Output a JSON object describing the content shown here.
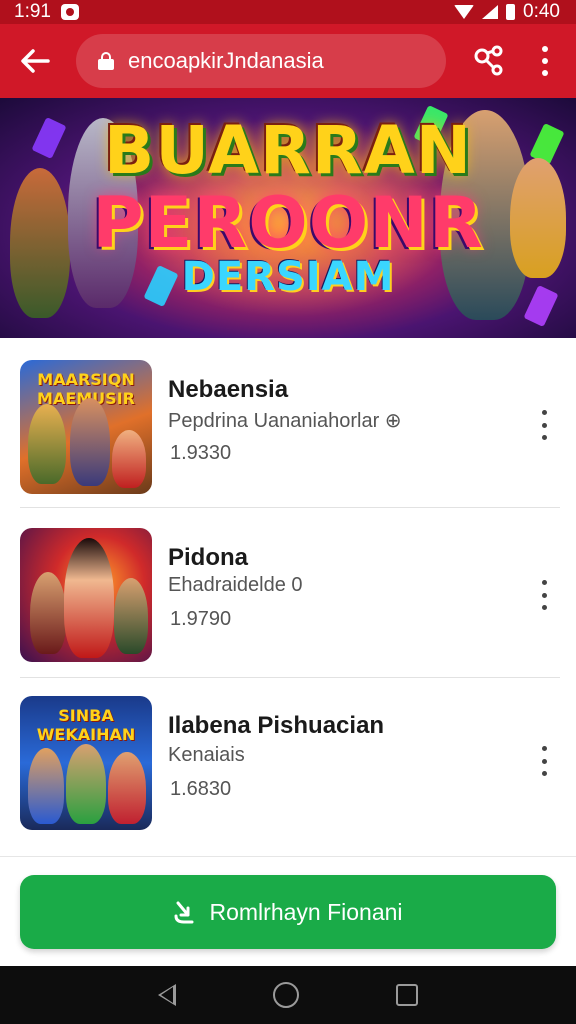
{
  "status_bar": {
    "time": "1:91",
    "clock_right": "0:40"
  },
  "browser": {
    "url": "encoapkirJndanasia",
    "icons": [
      "back-arrow-icon",
      "lock-icon",
      "share-icon",
      "more-vert-icon"
    ]
  },
  "banner": {
    "line1": "BUARRAN",
    "line2": "PEROONR",
    "line3": "DERSIAM"
  },
  "apps": [
    {
      "thumb_title": "MAARSIQN MAEMUSIR",
      "name": "Nebaensia",
      "subtitle": "Pepdrina Uananiahorlar ⊕",
      "count": "1.9330"
    },
    {
      "thumb_title": "",
      "name": "Pidona",
      "subtitle": "Ehadraidelde 0",
      "count": "1.9790"
    },
    {
      "thumb_title": "SINBA WEKAIHAN",
      "name": "Ilabena Pishuacian",
      "subtitle": "Kenaiais",
      "count": "1.6830"
    }
  ],
  "install_button": {
    "label": "Romlrhayn Fionani",
    "icon": "download-icon"
  },
  "colors": {
    "status_bar": "#b0101c",
    "toolbar": "#d01828",
    "install": "#1aab48",
    "nav_bar": "#0d0d0d"
  }
}
